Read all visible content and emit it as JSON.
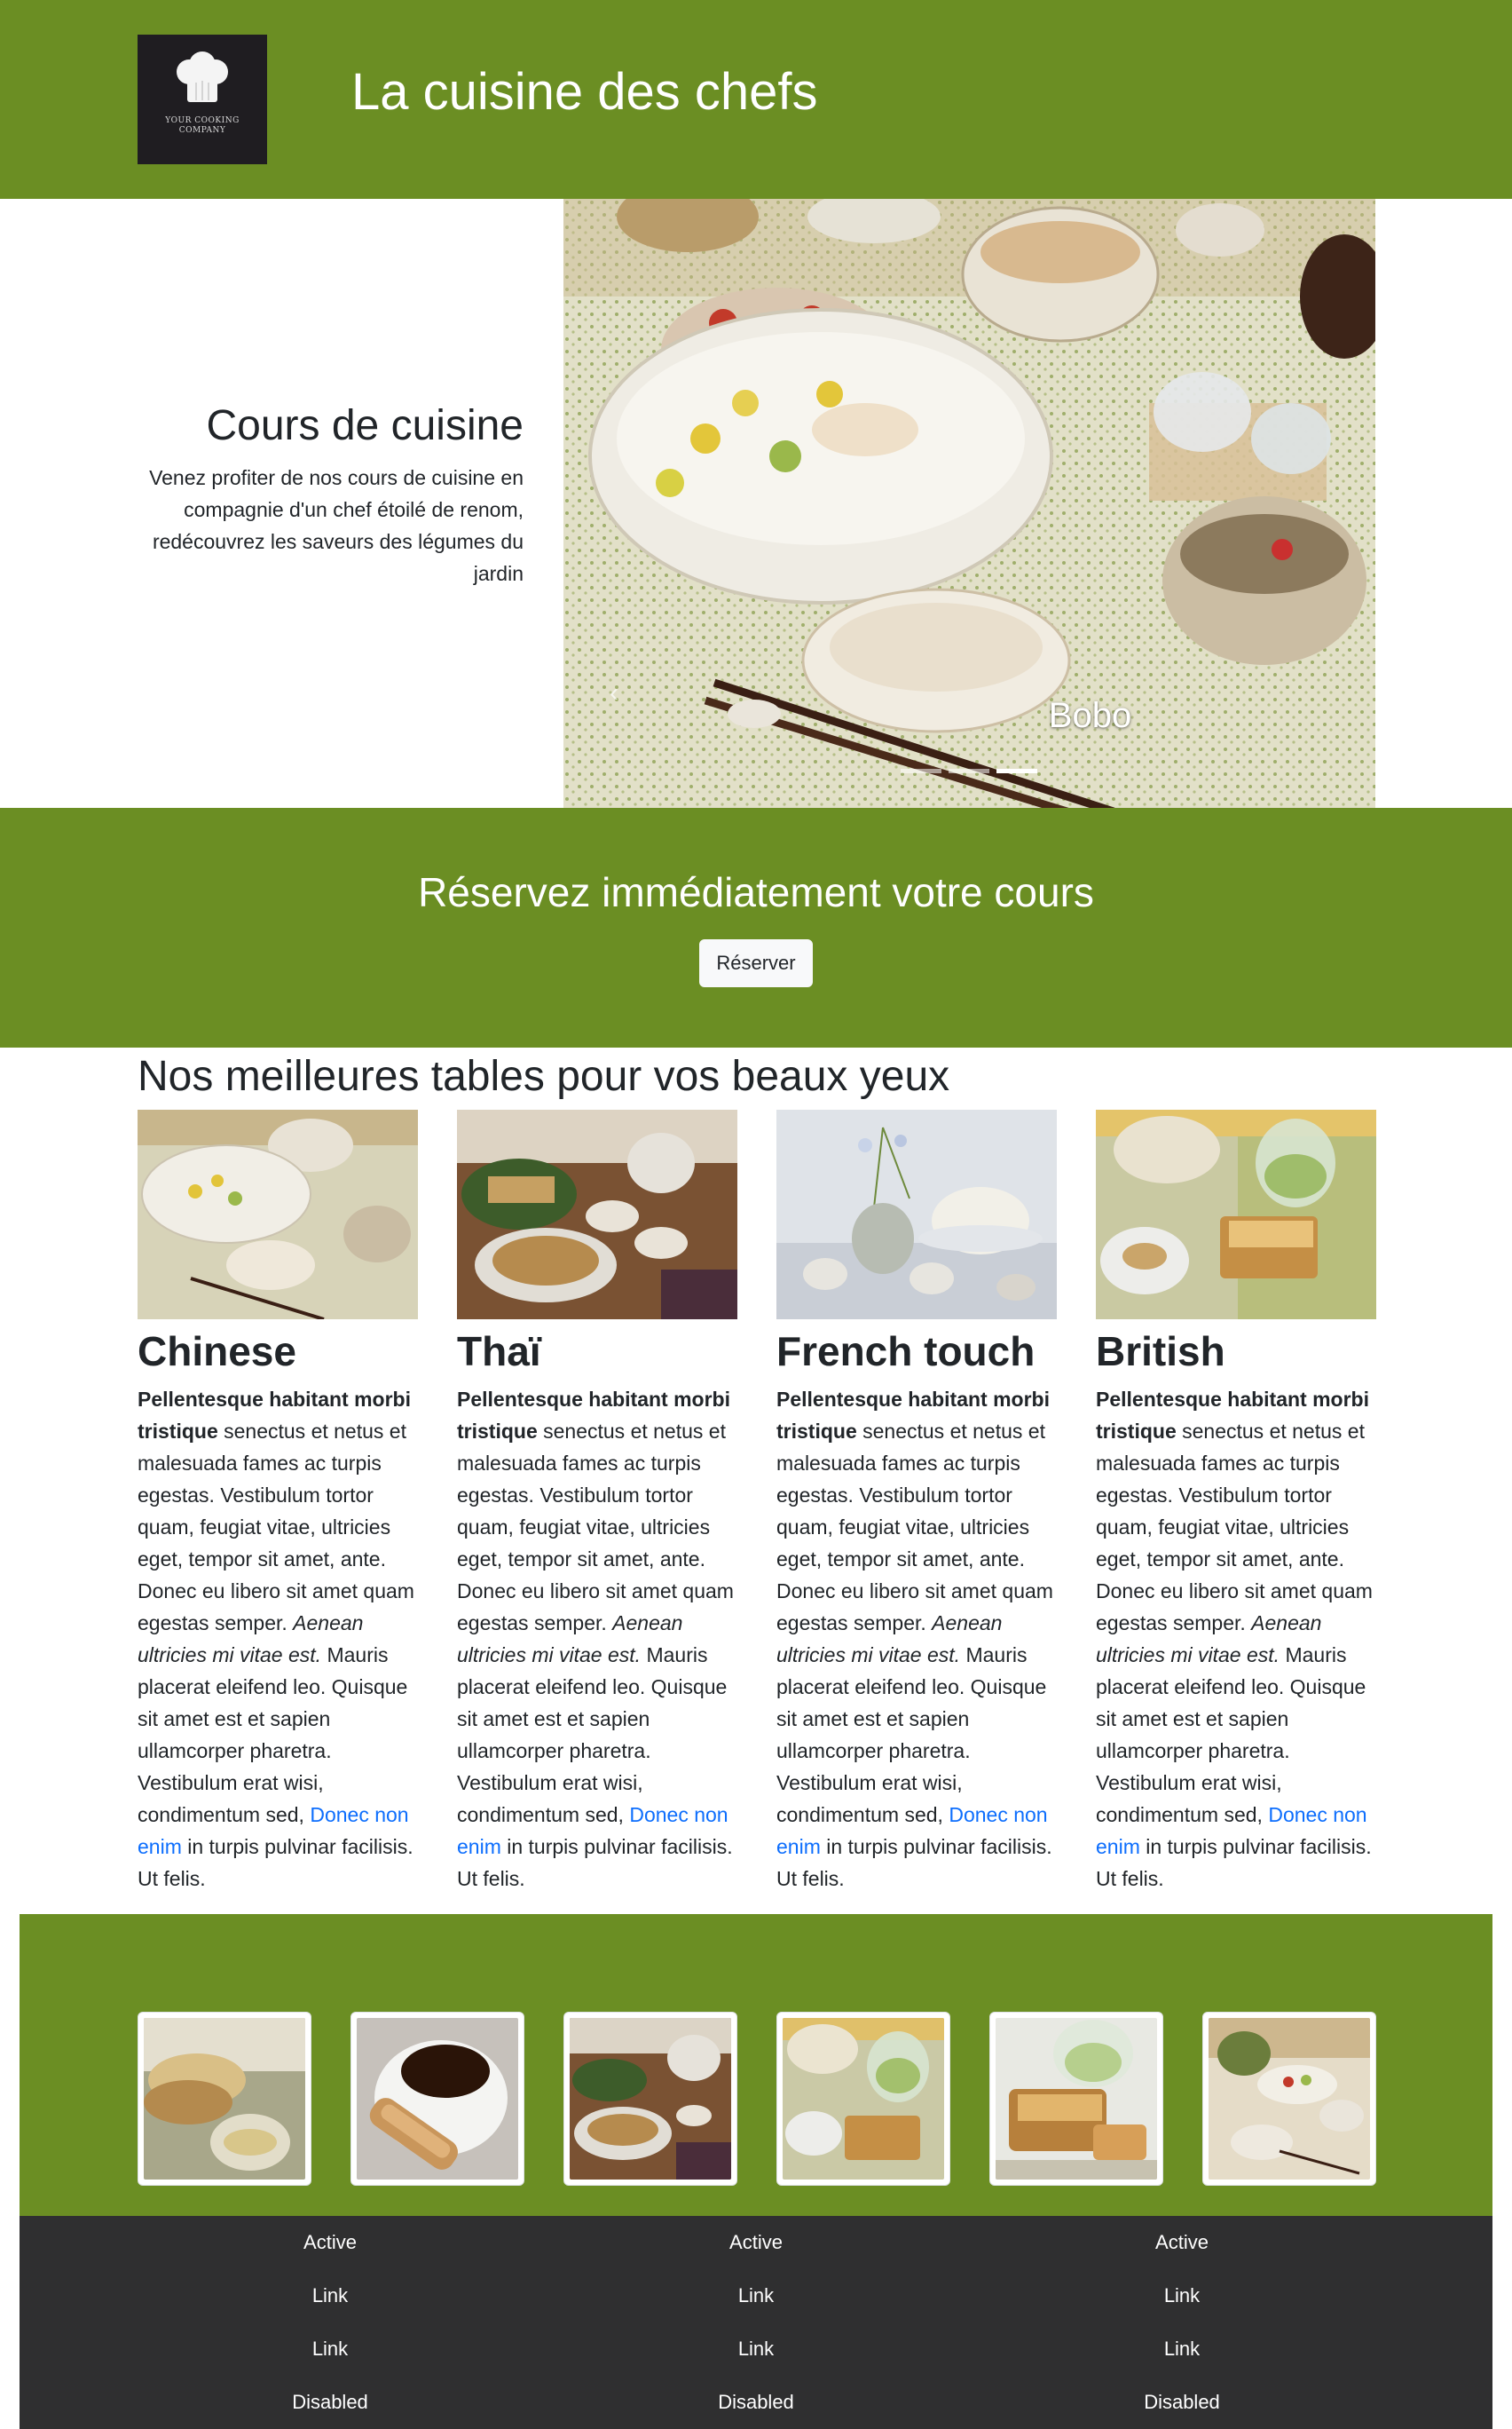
{
  "header": {
    "title": "La cuisine des chefs",
    "logo_line1": "YOUR COOKING",
    "logo_line2": "COMPANY",
    "color": "#6b8e23"
  },
  "hero": {
    "title": "Cours de cuisine",
    "description": "Venez profiter de nos cours de cuisine en compagnie d'un chef étoilé de renom, redécouvrez les saveurs des légumes du jardin",
    "carousel_caption": "Bobo",
    "slides_count": 3,
    "active_slide": 3
  },
  "reserve": {
    "title": "Réservez immédiatement votre cours",
    "button": "Réserver"
  },
  "tables": {
    "title": "Nos meilleures tables pour vos beaux yeux",
    "cards": [
      {
        "title": "Chinese",
        "bold": "Pellentesque habitant morbi tristique",
        "text1": " senectus et netus et malesuada fames ac turpis egestas. Vestibulum tortor quam, feugiat vitae, ultricies eget, tempor sit amet, ante. Donec eu libero sit amet quam egestas semper. ",
        "italic": "Aenean ultricies mi vitae est.",
        "text2": " Mauris placerat eleifend leo. Quisque sit amet est et sapien ullamcorper pharetra. Vestibulum erat wisi, condimentum sed, ",
        "link": "Donec non enim",
        "text3": " in turpis pulvinar facilisis. Ut felis."
      },
      {
        "title": "Thaï",
        "bold": "Pellentesque habitant morbi tristique",
        "text1": " senectus et netus et malesuada fames ac turpis egestas. Vestibulum tortor quam, feugiat vitae, ultricies eget, tempor sit amet, ante. Donec eu libero sit amet quam egestas semper. ",
        "italic": "Aenean ultricies mi vitae est.",
        "text2": " Mauris placerat eleifend leo. Quisque sit amet est et sapien ullamcorper pharetra. Vestibulum erat wisi, condimentum sed, ",
        "link": "Donec non enim",
        "text3": " in turpis pulvinar facilisis. Ut felis."
      },
      {
        "title": "French touch",
        "bold": "Pellentesque habitant morbi tristique",
        "text1": " senectus et netus et malesuada fames ac turpis egestas. Vestibulum tortor quam, feugiat vitae, ultricies eget, tempor sit amet, ante. Donec eu libero sit amet quam egestas semper. ",
        "italic": "Aenean ultricies mi vitae est.",
        "text2": " Mauris placerat eleifend leo. Quisque sit amet est et sapien ullamcorper pharetra. Vestibulum erat wisi, condimentum sed, ",
        "link": "Donec non enim",
        "text3": " in turpis pulvinar facilisis. Ut felis."
      },
      {
        "title": "British",
        "bold": "Pellentesque habitant morbi tristique",
        "text1": " senectus et netus et malesuada fames ac turpis egestas. Vestibulum tortor quam, feugiat vitae, ultricies eget, tempor sit amet, ante. Donec eu libero sit amet quam egestas semper. ",
        "italic": "Aenean ultricies mi vitae est.",
        "text2": " Mauris placerat eleifend leo. Quisque sit amet est et sapien ullamcorper pharetra. Vestibulum erat wisi, condimentum sed, ",
        "link": "Donec non enim",
        "text3": " in turpis pulvinar facilisis. Ut felis."
      }
    ]
  },
  "gallery": {
    "images": [
      "bread-and-tea-photo",
      "coffee-and-biscotti-photo",
      "dinner-table-photo",
      "tea-and-cake-photo",
      "pound-cake-photo",
      "table-setting-photo"
    ]
  },
  "footer": {
    "columns": [
      {
        "items": [
          "Active",
          "Link",
          "Link",
          "Disabled"
        ]
      },
      {
        "items": [
          "Active",
          "Link",
          "Link",
          "Disabled"
        ]
      },
      {
        "items": [
          "Active",
          "Link",
          "Link",
          "Disabled"
        ]
      }
    ]
  }
}
